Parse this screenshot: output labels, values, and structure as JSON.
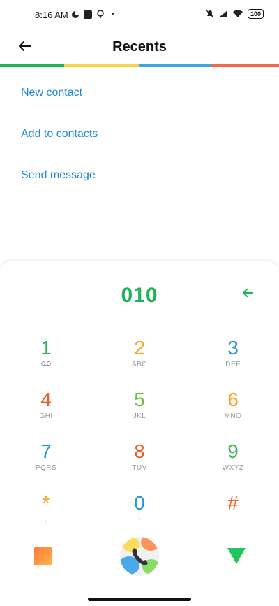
{
  "status": {
    "time": "8:16 AM",
    "battery": "100"
  },
  "header": {
    "title": "Recents"
  },
  "colors": {
    "green": "#1fb35a",
    "yellow": "#f5d547",
    "blue": "#3fa5e0",
    "red": "#f06a4a"
  },
  "menu": [
    {
      "label": "New contact"
    },
    {
      "label": "Add to contacts"
    },
    {
      "label": "Send message"
    }
  ],
  "dialer": {
    "number": "010",
    "keys": [
      {
        "digit": "1",
        "sub": "",
        "color": "#33b05a"
      },
      {
        "digit": "2",
        "sub": "ABC",
        "color": "#f2a424"
      },
      {
        "digit": "3",
        "sub": "DEF",
        "color": "#2a95d8"
      },
      {
        "digit": "4",
        "sub": "GHI",
        "color": "#e8622a"
      },
      {
        "digit": "5",
        "sub": "JKL",
        "color": "#6cc13a"
      },
      {
        "digit": "6",
        "sub": "MNO",
        "color": "#f2a424"
      },
      {
        "digit": "7",
        "sub": "PQRS",
        "color": "#2a95d8"
      },
      {
        "digit": "8",
        "sub": "TUV",
        "color": "#e8622a"
      },
      {
        "digit": "9",
        "sub": "WXYZ",
        "color": "#45b85a"
      },
      {
        "digit": "*",
        "sub": ",",
        "color": "#f2a424"
      },
      {
        "digit": "0",
        "sub": "+",
        "color": "#2a95d8"
      },
      {
        "digit": "#",
        "sub": "",
        "color": "#e8622a"
      }
    ]
  },
  "icons": {
    "back": "arrow-left-icon",
    "delete": "backspace-icon",
    "voicemail": "voicemail-icon",
    "call": "phone-icon",
    "hide_keypad": "chevron-down-icon",
    "dialpad_menu": "square-icon"
  }
}
